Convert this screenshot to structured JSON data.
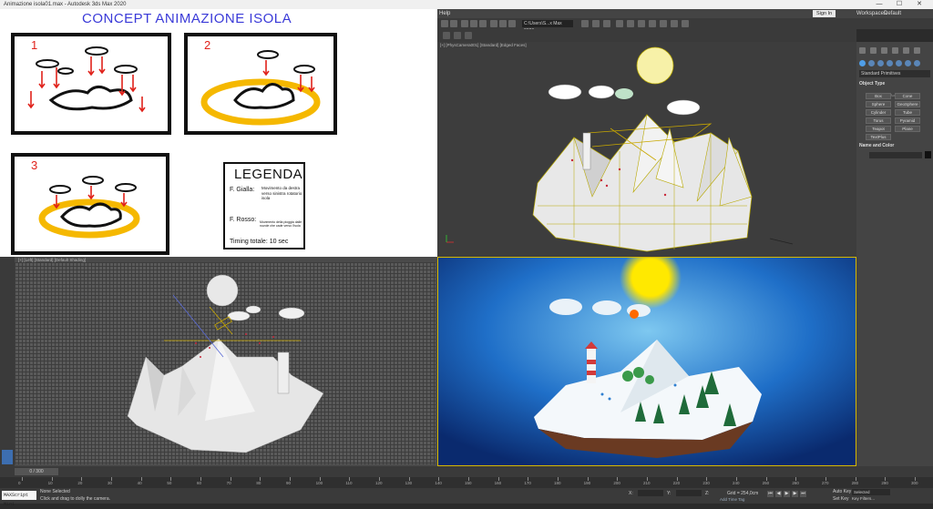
{
  "window": {
    "title": "Animazione isola01.max - Autodesk 3ds Max 2020",
    "controls": [
      "—",
      "☐",
      "✕"
    ]
  },
  "menubar": {
    "help": "Help",
    "sign_in": "Sign In",
    "workspaces_label": "Workspaces:",
    "workspaces_value": "Default",
    "project_path": "C:\\Users\\S...x Max 2020"
  },
  "concept": {
    "title": "CONCEPT ANIMAZIONE ISOLA",
    "frames": [
      "1",
      "2",
      "3"
    ],
    "legend": {
      "title": "LEGENDA",
      "yellow_label": "F. Gialla:",
      "yellow_desc": "Movimento da destra verso sinistra rotatorio isola",
      "red_label": "F. Rosso:",
      "red_desc": "Movimento della pioggia dalle nuvole che cade verso l'isola",
      "timing": "Timing totale: 10 sec"
    },
    "colors": {
      "title": "#3a3ad8",
      "red": "#e0221b",
      "yellow": "#f5b800"
    }
  },
  "viewports": {
    "top_right": "[+] [PhysCamera001] [Standard] [Edged Faces]",
    "bottom_left": "[+] [Left] [Standard] [Default Shading]",
    "bottom_right": ""
  },
  "command_panel": {
    "category": "Standard Primitives",
    "object_type_header": "Object Type",
    "autogrid": "AutoGrid",
    "buttons": [
      "Box",
      "Cone",
      "Sphere",
      "GeoSphere",
      "Cylinder",
      "Tube",
      "Torus",
      "Pyramid",
      "Teapot",
      "Plane",
      "TextPlus"
    ],
    "name_color_header": "Name and Color"
  },
  "timeline": {
    "slider": "0 / 300",
    "ticks": [
      "0",
      "10",
      "20",
      "30",
      "40",
      "50",
      "60",
      "70",
      "80",
      "90",
      "100",
      "110",
      "120",
      "130",
      "140",
      "150",
      "160",
      "170",
      "180",
      "190",
      "200",
      "210",
      "220",
      "230",
      "240",
      "250",
      "260",
      "270",
      "280",
      "290",
      "300"
    ]
  },
  "status": {
    "maxscript": "MAXScript Mini",
    "selection": "None Selected",
    "prompt": "Click and drag to dolly the camera.",
    "x_label": "X:",
    "y_label": "Y:",
    "z_label": "Z:",
    "grid": "Grid = 254,0cm",
    "add_time_tag": "Add Time Tag",
    "auto_key": "Auto Key",
    "set_key": "Set Key",
    "selected": "Selected",
    "key_filters": "Key Filters..."
  }
}
